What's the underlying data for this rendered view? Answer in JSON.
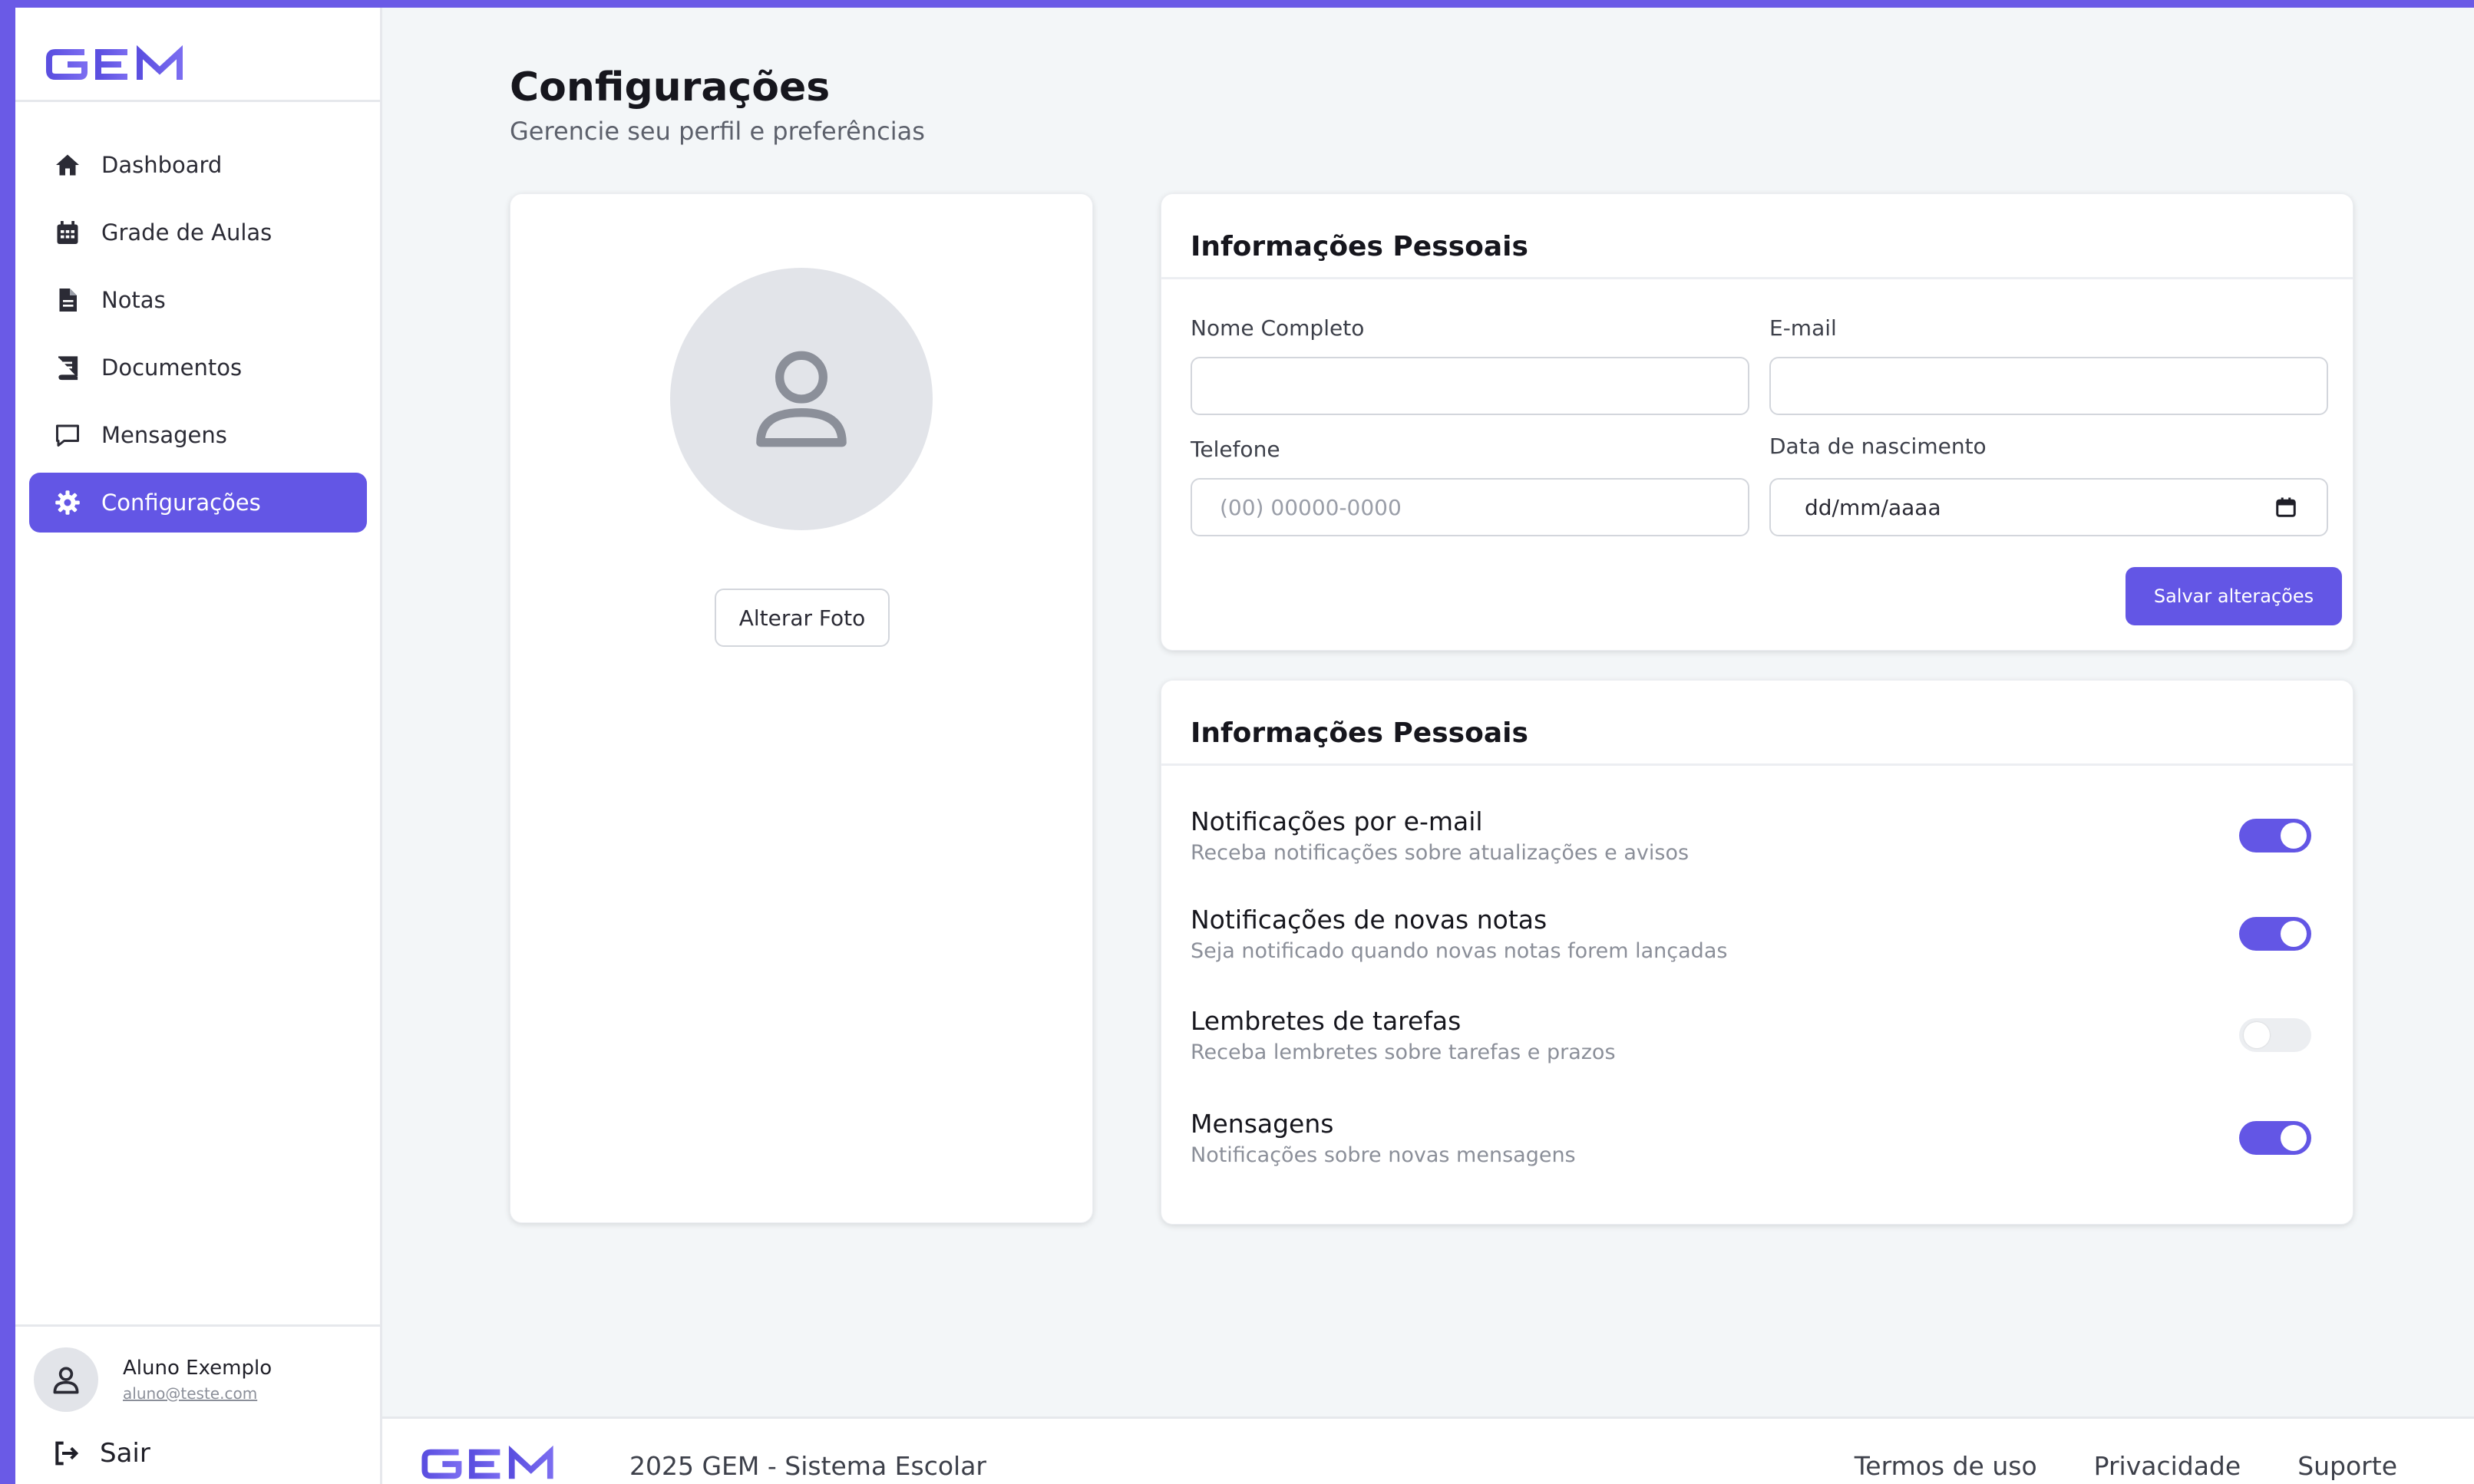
{
  "brand": {
    "name": "GEM",
    "accent": "#6356e5",
    "frame": "#6a5ae6"
  },
  "sidebar": {
    "items": [
      {
        "label": "Dashboard",
        "icon": "home-icon",
        "active": false
      },
      {
        "label": "Grade de Aulas",
        "icon": "calendar-icon",
        "active": false
      },
      {
        "label": "Notas",
        "icon": "file-icon",
        "active": false
      },
      {
        "label": "Documentos",
        "icon": "book-icon",
        "active": false
      },
      {
        "label": "Mensagens",
        "icon": "message-icon",
        "active": false
      },
      {
        "label": "Configurações",
        "icon": "gear-icon",
        "active": true
      }
    ],
    "user": {
      "name": "Aluno Exemplo",
      "email": "aluno@teste.com"
    },
    "logout_label": "Sair"
  },
  "page": {
    "title": "Configurações",
    "subtitle": "Gerencie seu perfil e preferências"
  },
  "photo_card": {
    "change_photo_label": "Alterar Foto"
  },
  "info_card": {
    "title": "Informações Pessoais",
    "name_label": "Nome Completo",
    "name_value": "",
    "email_label": "E-mail",
    "email_value": "",
    "phone_label": "Telefone",
    "phone_placeholder": "(00) 00000-0000",
    "birth_label": "Data de nascimento",
    "birth_value": "dd/mm/aaaa",
    "save_label": "Salvar alterações"
  },
  "prefs_card": {
    "title": "Informações Pessoais",
    "items": [
      {
        "title": "Notificações por e-mail",
        "desc": "Receba notificações sobre atualizações e avisos",
        "enabled": true
      },
      {
        "title": "Notificações  de novas notas",
        "desc": "Seja notificado quando novas notas forem lançadas",
        "enabled": true
      },
      {
        "title": "Lembretes de tarefas",
        "desc": "Receba lembretes sobre tarefas e prazos",
        "enabled": false
      },
      {
        "title": "Mensagens",
        "desc": "Notificações sobre novas mensagens",
        "enabled": true
      }
    ]
  },
  "footer": {
    "copyright": "2025 GEM - Sistema Escolar",
    "links": [
      "Termos de uso",
      "Privacidade",
      "Suporte"
    ]
  }
}
